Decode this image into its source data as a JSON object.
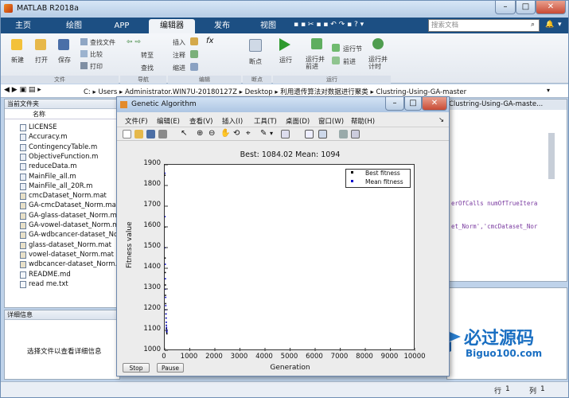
{
  "app": {
    "title": "MATLAB R2018a"
  },
  "tabs": [
    {
      "label": "主页"
    },
    {
      "label": "绘图"
    },
    {
      "label": "APP"
    },
    {
      "label": "编辑器"
    },
    {
      "label": "发布"
    },
    {
      "label": "视图"
    }
  ],
  "search": {
    "placeholder": "搜索文档"
  },
  "ribbon": {
    "file": {
      "new": "新建",
      "open": "打开",
      "save": "保存",
      "find_files": "查找文件",
      "compare": "比较",
      "print": "打印",
      "group": "文件"
    },
    "nav": {
      "goto": "转至",
      "find": "查找",
      "group": "导航"
    },
    "edit": {
      "insert": "插入",
      "comment": "注释",
      "indent": "缩进",
      "fx": "fx",
      "group": "编辑"
    },
    "bp": {
      "breakpoint": "断点",
      "group": "断点"
    },
    "run": {
      "run": "运行",
      "run_advance": "运行并\n前进",
      "run_section": "运行节",
      "advance": "前进",
      "run_time": "运行并\n计时",
      "group": "运行"
    }
  },
  "path": [
    "C:",
    "Users",
    "Administrator.WIN7U-20180127Z",
    "Desktop",
    "利用遗传算法对数据进行聚类",
    "Clustring-Using-GA-master"
  ],
  "current_folder": {
    "title": "当前文件夹",
    "col_name": "名称",
    "files": [
      "LICENSE",
      "Accuracy.m",
      "ContingencyTable.m",
      "ObjectiveFunction.m",
      "reduceData.m",
      "MainFile_all.m",
      "MainFile_all_20R.m",
      "cmcDataset_Norm.mat",
      "GA-cmcDataset_Norm.mat",
      "GA-glass-dataset_Norm.mat",
      "GA-vowel-dataset_Norm.mat",
      "GA-wdbcancer-dataset_Norm.mat",
      "glass-dataset_Norm.mat",
      "vowel-dataset_Norm.mat",
      "wdbcancer-dataset_Norm.mat",
      "README.md",
      "read me.txt"
    ]
  },
  "details": {
    "title": "详细信息",
    "hint": "选择文件以查看详细信息"
  },
  "editor": {
    "tab_title": "Clustring-Using-GA-maste...",
    "code1": "erOfCalls numOfTrueItera",
    "code2": "et_Norm','cmcDataset_Nor"
  },
  "ga_window": {
    "title": "Genetic Algorithm",
    "menu": [
      "文件(F)",
      "编辑(E)",
      "查看(V)",
      "插入(I)",
      "工具(T)",
      "桌面(D)",
      "窗口(W)",
      "帮助(H)"
    ],
    "stop": "Stop",
    "pause": "Pause"
  },
  "chart_data": {
    "type": "scatter",
    "title": "Best: 1084.02 Mean: 1094",
    "xlabel": "Generation",
    "ylabel": "Fitness value",
    "xlim": [
      0,
      10000
    ],
    "ylim": [
      1000,
      1900
    ],
    "xticks": [
      "0",
      "1000",
      "2000",
      "3000",
      "4000",
      "5000",
      "6000",
      "7000",
      "8000",
      "9000",
      "10000"
    ],
    "yticks": [
      "1000",
      "1100",
      "1200",
      "1300",
      "1400",
      "1500",
      "1600",
      "1700",
      "1800",
      "1900"
    ],
    "legend_placement": "top-right",
    "series": [
      {
        "name": "Best fitness",
        "color": "#000000",
        "x": [
          0,
          5,
          10,
          15,
          20,
          25,
          30,
          35,
          40,
          45,
          50,
          55,
          60,
          65,
          70,
          75,
          80
        ],
        "y": [
          1850,
          1600,
          1450,
          1380,
          1320,
          1270,
          1230,
          1200,
          1180,
          1160,
          1140,
          1125,
          1110,
          1100,
          1095,
          1090,
          1084
        ]
      },
      {
        "name": "Mean fitness",
        "color": "#0000cc",
        "x": [
          0,
          5,
          10,
          15,
          20,
          25,
          30,
          35,
          40,
          45,
          50,
          55,
          60,
          65,
          70,
          75,
          80
        ],
        "y": [
          1860,
          1650,
          1500,
          1420,
          1350,
          1300,
          1260,
          1220,
          1200,
          1180,
          1160,
          1140,
          1125,
          1115,
          1105,
          1100,
          1094
        ]
      }
    ]
  },
  "watermark": {
    "brand": "必过源码",
    "domain": "Biguo100.com"
  },
  "status": {
    "line_label": "行",
    "line": "1",
    "col_label": "列",
    "col": "1"
  }
}
